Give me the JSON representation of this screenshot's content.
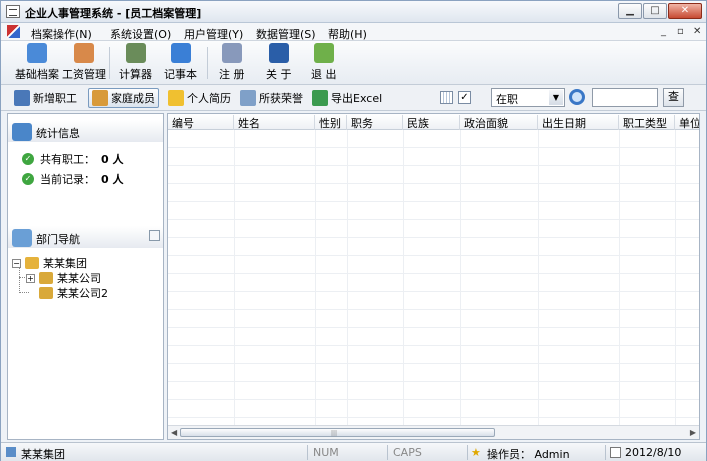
{
  "window": {
    "title": "企业人事管理系统 - [员工档案管理]"
  },
  "menu": {
    "items": [
      "档案操作(N)",
      "系统设置(O)",
      "用户管理(Y)",
      "数据管理(S)",
      "帮助(H)"
    ]
  },
  "toolbar": {
    "buttons": [
      {
        "label": "基础档案",
        "icon": "archive-icon",
        "color": "#4a8ad8"
      },
      {
        "label": "工资管理",
        "icon": "salary-icon",
        "color": "#d8894a"
      },
      {
        "label": "计算器",
        "icon": "calculator-icon",
        "color": "#6a8c5a"
      },
      {
        "label": "记事本",
        "icon": "notepad-icon",
        "color": "#3a7fd6"
      },
      {
        "label": "注 册",
        "icon": "register-icon",
        "color": "#8899bb"
      },
      {
        "label": "关 于",
        "icon": "about-icon",
        "color": "#2a5ea8"
      },
      {
        "label": "退 出",
        "icon": "exit-icon",
        "color": "#6fb04a"
      }
    ]
  },
  "toolbar2": {
    "buttons": [
      {
        "label": "新增职工",
        "icon": "add-employee-icon",
        "color": "#4a78b8"
      },
      {
        "label": "家庭成员",
        "icon": "family-icon",
        "color": "#d89a3a"
      },
      {
        "label": "个人简历",
        "icon": "resume-icon",
        "color": "#f0c030"
      },
      {
        "label": "所获荣誉",
        "icon": "honor-icon",
        "color": "#7fa0c8"
      },
      {
        "label": "导出Excel",
        "icon": "excel-export-icon",
        "color": "#3b9a4e"
      }
    ],
    "status_select": "在职",
    "query_label": "查"
  },
  "stats": {
    "title": "统计信息",
    "total_label": "共有职工：",
    "total_value": "0 人",
    "current_label": "当前记录：",
    "current_value": "0 人"
  },
  "dept_nav": {
    "title": "部门导航",
    "root": "某某集团",
    "children": [
      "某某公司",
      "某某公司2"
    ]
  },
  "grid": {
    "columns": [
      "编号",
      "姓名",
      "性别",
      "职务",
      "民族",
      "政治面貌",
      "出生日期",
      "职工类型",
      "单位"
    ]
  },
  "statusbar": {
    "group": "某某集团",
    "num": "NUM",
    "caps": "CAPS",
    "operator": "操作员： Admin",
    "date": "2012/8/10"
  }
}
